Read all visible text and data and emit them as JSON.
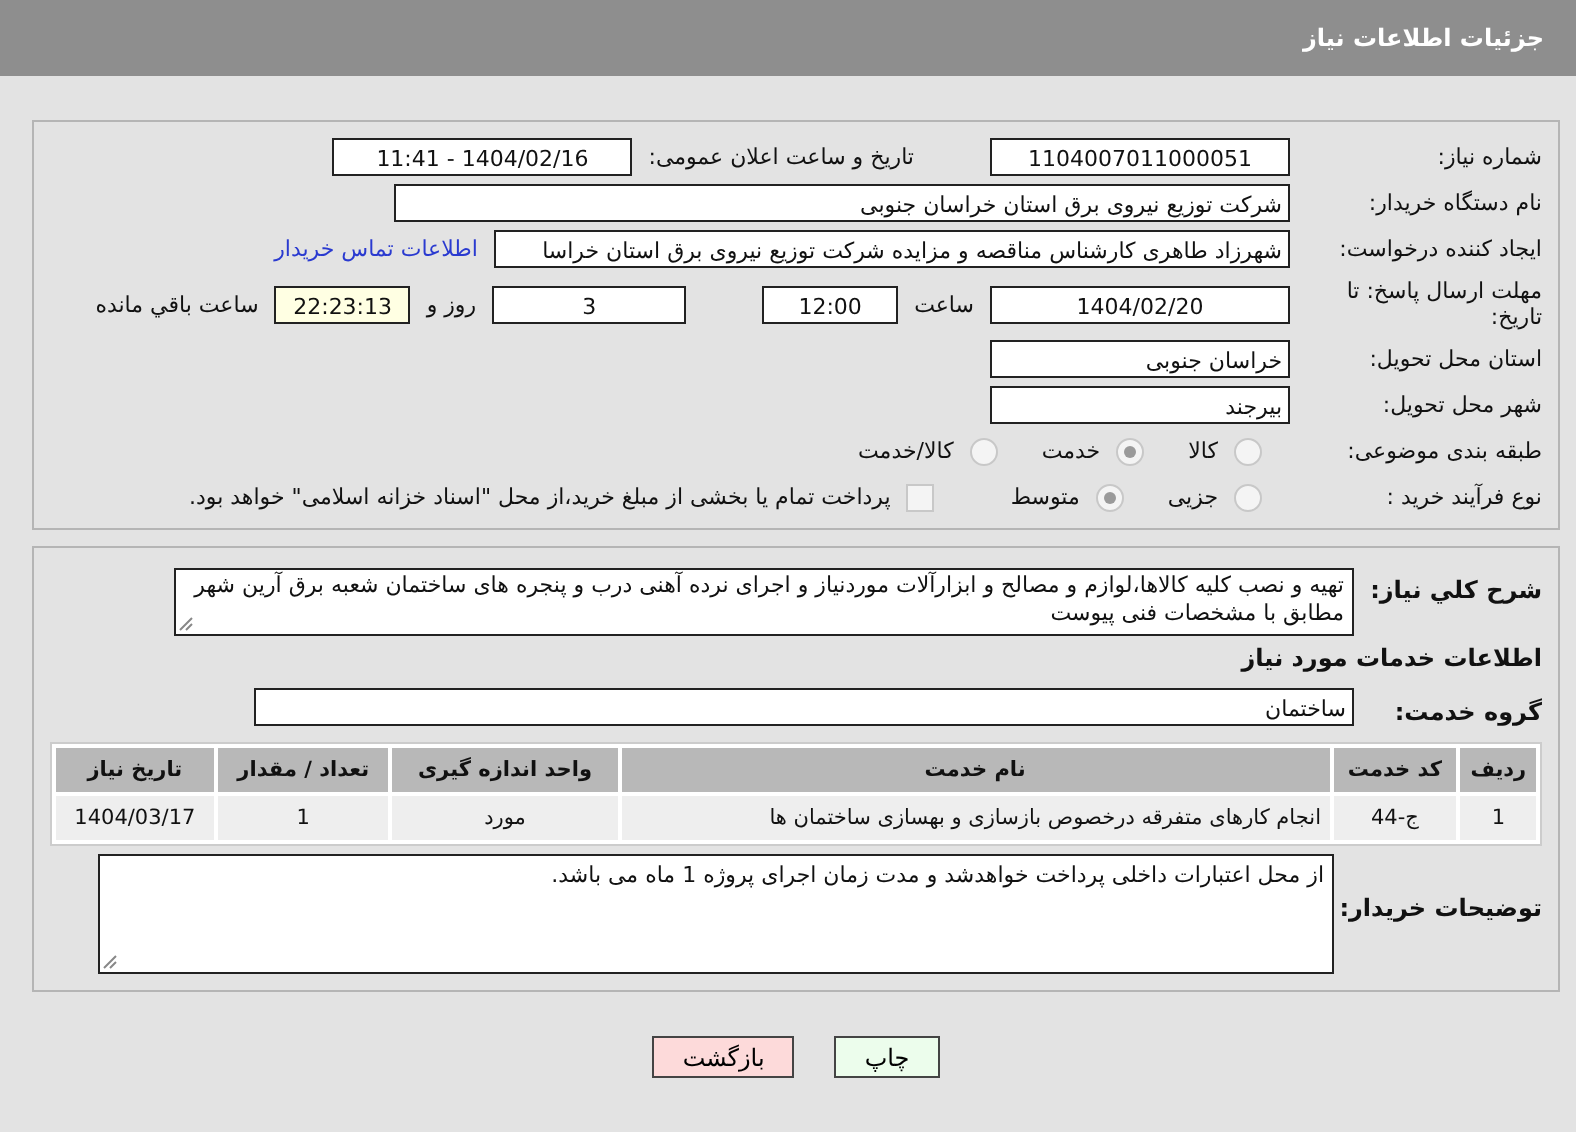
{
  "header": {
    "title": "جزئیات اطلاعات نیاز"
  },
  "details": {
    "need_number": {
      "label": "شماره نیاز:",
      "value": "1104007011000051"
    },
    "announce": {
      "label": "تاریخ و ساعت اعلان عمومی:",
      "value": "1404/02/16 - 11:41"
    },
    "buyer": {
      "label": "نام دستگاه خریدار:",
      "value": "شرکت توزیع نیروی برق استان خراسان جنوبی"
    },
    "creator": {
      "label": "ایجاد کننده درخواست:",
      "value": "شهرزاد طاهری کارشناس مناقصه و مزایده شرکت توزیع نیروی برق استان خراسا",
      "link": "اطلاعات تماس خریدار"
    },
    "deadline": {
      "label": "مهلت ارسال پاسخ: تا تاریخ:",
      "date": "1404/02/20",
      "time_label": "ساعت",
      "time": "12:00",
      "days": "3",
      "days_label": "روز و",
      "remaining": "22:23:13",
      "remaining_label": "ساعت باقي مانده"
    },
    "province": {
      "label": "استان محل تحویل:",
      "value": "خراسان جنوبی"
    },
    "city": {
      "label": "شهر محل تحویل:",
      "value": "بیرجند"
    },
    "category": {
      "label": "طبقه بندی موضوعی:",
      "options": [
        {
          "label": "کالا",
          "selected": false
        },
        {
          "label": "خدمت",
          "selected": true
        },
        {
          "label": "کالا/خدمت",
          "selected": false
        }
      ]
    },
    "process": {
      "label": "نوع فرآیند خرید :",
      "options": [
        {
          "label": "جزیی",
          "selected": false
        },
        {
          "label": "متوسط",
          "selected": true
        }
      ],
      "treasury": {
        "label": "پرداخت تمام یا بخشی از مبلغ خرید،از محل \"اسناد خزانه اسلامی\" خواهد بود.",
        "checked": false
      }
    }
  },
  "description": {
    "label": "شرح کلي نياز:",
    "value": "تهیه و نصب کلیه کالاها،لوازم و مصالح و ابزارآلات موردنیاز و اجرای نرده آهنی درب و پنجره های ساختمان شعبه برق آرین شهر مطابق با مشخصات فنی پیوست"
  },
  "services": {
    "heading": "اطلاعات خدمات مورد نیاز",
    "group_label": "گروه خدمت:",
    "group": "ساختمان",
    "table": {
      "columns": [
        "ردیف",
        "کد خدمت",
        "نام خدمت",
        "واحد اندازه گیری",
        "تعداد / مقدار",
        "تاریخ نیاز"
      ],
      "rows": [
        [
          "1",
          "ج-44",
          "انجام کارهای متفرقه درخصوص بازسازی و بهسازی ساختمان ها",
          "مورد",
          "1",
          "1404/03/17"
        ]
      ]
    }
  },
  "notes": {
    "label": "توضیحات خریدار:",
    "value": "از محل اعتبارات داخلی پرداخت خواهدشد و مدت زمان اجرای پروژه 1 ماه می باشد."
  },
  "buttons": [
    {
      "label": "چاپ",
      "kind": "print"
    },
    {
      "label": "بازگشت",
      "kind": "back"
    }
  ]
}
